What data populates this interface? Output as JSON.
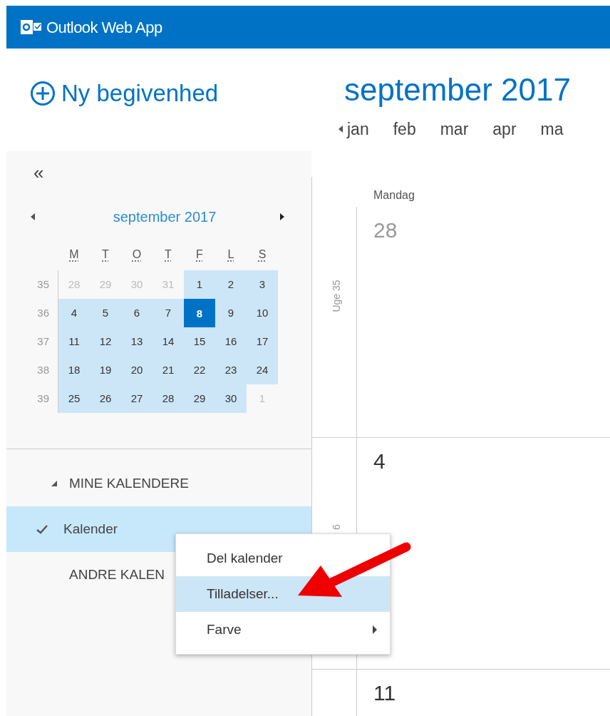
{
  "app": {
    "title": "Outlook Web App"
  },
  "new_event": {
    "label": "Ny begivenhed"
  },
  "view_title": "september 2017",
  "month_strip": {
    "months": [
      "jan",
      "feb",
      "mar",
      "apr",
      "ma"
    ]
  },
  "sidebar": {
    "collapse": "«",
    "mini_calendar": {
      "title": "september 2017",
      "weekdays": [
        "M",
        "T",
        "O",
        "T",
        "F",
        "L",
        "S"
      ],
      "weeks": [
        {
          "number": "35",
          "days": [
            {
              "label": "28",
              "in_range": false,
              "selected": false
            },
            {
              "label": "29",
              "in_range": false,
              "selected": false
            },
            {
              "label": "30",
              "in_range": false,
              "selected": false
            },
            {
              "label": "31",
              "in_range": false,
              "selected": false
            },
            {
              "label": "1",
              "in_range": true,
              "selected": false
            },
            {
              "label": "2",
              "in_range": true,
              "selected": false
            },
            {
              "label": "3",
              "in_range": true,
              "selected": false
            }
          ]
        },
        {
          "number": "36",
          "days": [
            {
              "label": "4",
              "in_range": true,
              "selected": false
            },
            {
              "label": "5",
              "in_range": true,
              "selected": false
            },
            {
              "label": "6",
              "in_range": true,
              "selected": false
            },
            {
              "label": "7",
              "in_range": true,
              "selected": false
            },
            {
              "label": "8",
              "in_range": true,
              "selected": true
            },
            {
              "label": "9",
              "in_range": true,
              "selected": false
            },
            {
              "label": "10",
              "in_range": true,
              "selected": false
            }
          ]
        },
        {
          "number": "37",
          "days": [
            {
              "label": "11",
              "in_range": true,
              "selected": false
            },
            {
              "label": "12",
              "in_range": true,
              "selected": false
            },
            {
              "label": "13",
              "in_range": true,
              "selected": false
            },
            {
              "label": "14",
              "in_range": true,
              "selected": false
            },
            {
              "label": "15",
              "in_range": true,
              "selected": false
            },
            {
              "label": "16",
              "in_range": true,
              "selected": false
            },
            {
              "label": "17",
              "in_range": true,
              "selected": false
            }
          ]
        },
        {
          "number": "38",
          "days": [
            {
              "label": "18",
              "in_range": true,
              "selected": false
            },
            {
              "label": "19",
              "in_range": true,
              "selected": false
            },
            {
              "label": "20",
              "in_range": true,
              "selected": false
            },
            {
              "label": "21",
              "in_range": true,
              "selected": false
            },
            {
              "label": "22",
              "in_range": true,
              "selected": false
            },
            {
              "label": "23",
              "in_range": true,
              "selected": false
            },
            {
              "label": "24",
              "in_range": true,
              "selected": false
            }
          ]
        },
        {
          "number": "39",
          "days": [
            {
              "label": "25",
              "in_range": true,
              "selected": false
            },
            {
              "label": "26",
              "in_range": true,
              "selected": false
            },
            {
              "label": "27",
              "in_range": true,
              "selected": false
            },
            {
              "label": "28",
              "in_range": true,
              "selected": false
            },
            {
              "label": "29",
              "in_range": true,
              "selected": false
            },
            {
              "label": "30",
              "in_range": true,
              "selected": false
            },
            {
              "label": "1",
              "in_range": false,
              "selected": false
            }
          ]
        }
      ]
    },
    "calendars": [
      {
        "kind": "header",
        "label": "MINE KALENDERE",
        "expanded": true
      },
      {
        "kind": "calendar",
        "label": "Kalender",
        "checked": true,
        "selected": true
      },
      {
        "kind": "header",
        "label": "ANDRE KALEN"
      }
    ]
  },
  "main_calendar": {
    "day_header": "Mandag",
    "weeks": [
      {
        "week_label": "Uge 35",
        "day": "28",
        "in_month": false
      },
      {
        "week_label": "6",
        "day": "4",
        "in_month": true
      },
      {
        "day": "11",
        "in_month": true
      }
    ]
  },
  "context_menu": {
    "items": [
      {
        "label": "Del kalender",
        "selected": false,
        "submenu": false
      },
      {
        "label": "Tilladelser...",
        "selected": true,
        "submenu": false
      },
      {
        "label": "Farve",
        "selected": false,
        "submenu": true
      }
    ]
  }
}
